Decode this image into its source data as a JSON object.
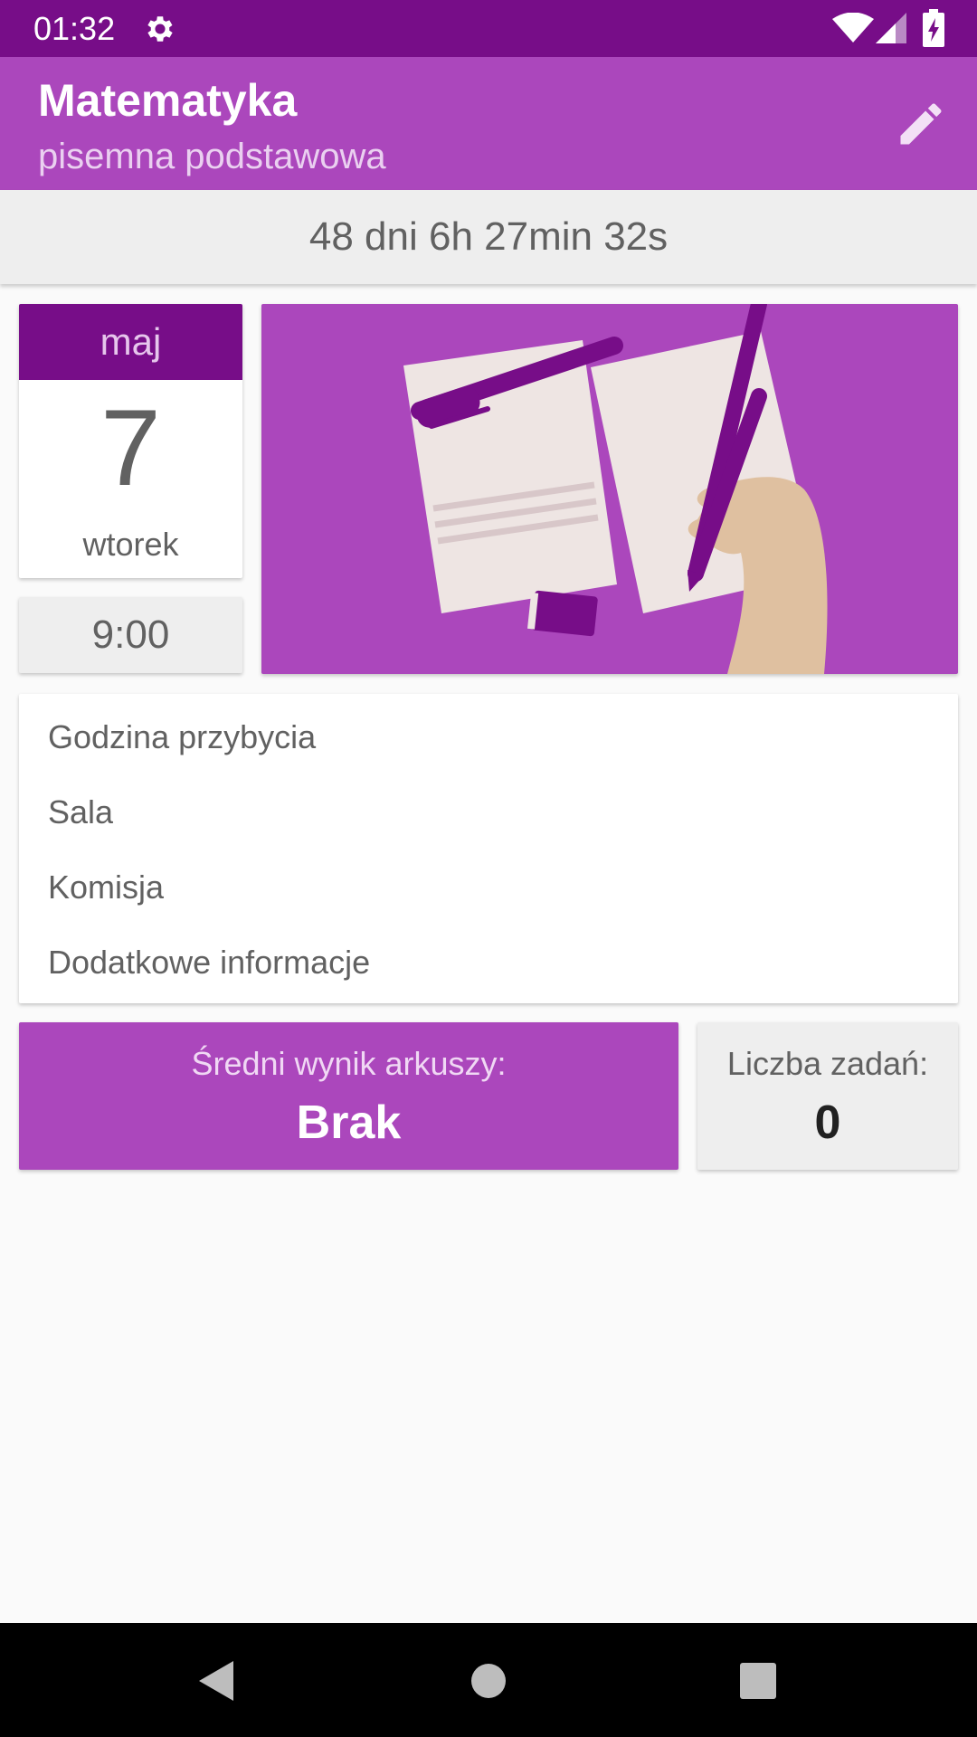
{
  "status_bar": {
    "time": "01:32",
    "icons": [
      "gear-icon",
      "wifi-icon",
      "signal-icon",
      "battery-charging-icon"
    ]
  },
  "app_bar": {
    "title": "Matematyka",
    "subtitle": "pisemna podstawowa",
    "edit_icon": "pencil-icon"
  },
  "countdown": "48 dni 6h 27min 32s",
  "exam_date": {
    "month": "maj",
    "day": "7",
    "weekday": "wtorek",
    "time": "9:00"
  },
  "details": {
    "arrival_time_label": "Godzina przybycia",
    "room_label": "Sala",
    "committee_label": "Komisja",
    "additional_info_label": "Dodatkowe informacje"
  },
  "stats": {
    "average_label": "Średni wynik arkuszy:",
    "average_value": "Brak",
    "task_count_label": "Liczba zadań:",
    "task_count_value": "0"
  },
  "colors": {
    "status_bar": "#770d88",
    "primary": "#ab47bc",
    "primary_dark": "#770d88",
    "card_gray": "#eeeeee",
    "background": "#fafafa"
  },
  "nav_bar": [
    "back-icon",
    "home-icon",
    "recents-icon"
  ]
}
